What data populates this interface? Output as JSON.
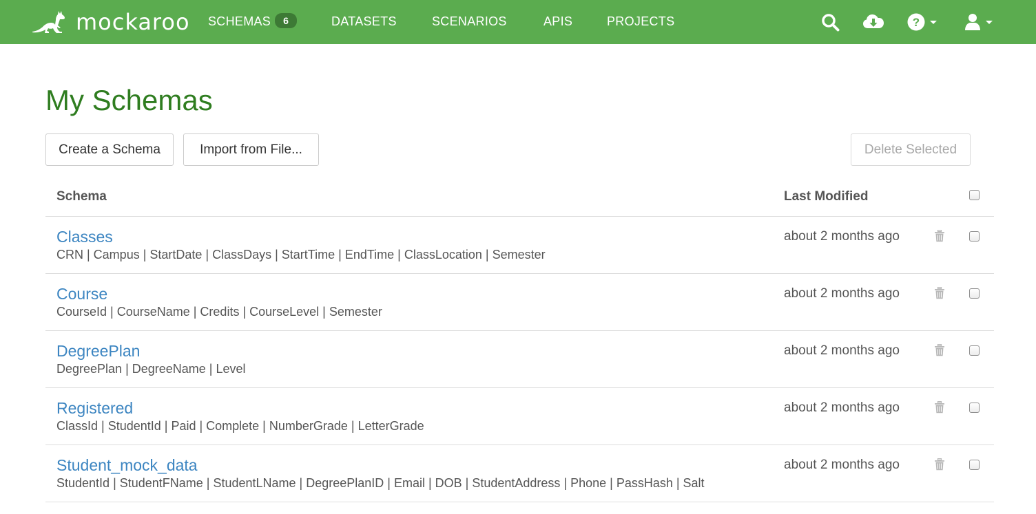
{
  "nav": {
    "brand": "mockaroo",
    "items": [
      {
        "label": "SCHEMAS",
        "badge": "6"
      },
      {
        "label": "DATASETS"
      },
      {
        "label": "SCENARIOS"
      },
      {
        "label": "APIS"
      },
      {
        "label": "PROJECTS"
      }
    ],
    "icons": [
      "search-icon",
      "cloud-download-icon",
      "help-icon",
      "user-icon"
    ]
  },
  "page": {
    "title": "My Schemas",
    "create_label": "Create a Schema",
    "import_label": "Import from File...",
    "delete_label": "Delete Selected"
  },
  "table": {
    "headers": {
      "schema": "Schema",
      "modified": "Last Modified"
    },
    "rows": [
      {
        "name": "Classes",
        "fields": "CRN | Campus | StartDate | ClassDays | StartTime | EndTime | ClassLocation | Semester",
        "modified": "about 2 months ago"
      },
      {
        "name": "Course",
        "fields": "CourseId | CourseName | Credits | CourseLevel | Semester",
        "modified": "about 2 months ago"
      },
      {
        "name": "DegreePlan",
        "fields": "DegreePlan | DegreeName | Level",
        "modified": "about 2 months ago"
      },
      {
        "name": "Registered",
        "fields": "ClassId | StudentId | Paid | Complete | NumberGrade | LetterGrade",
        "modified": "about 2 months ago"
      },
      {
        "name": "Student_mock_data",
        "fields": "StudentId | StudentFName | StudentLName | DegreePlanID | Email | DOB | StudentAddress | Phone | PassHash | Salt",
        "modified": "about 2 months ago"
      }
    ]
  },
  "colors": {
    "navbar": "#5bac4f",
    "badge": "#3d7a35",
    "title": "#2f7d20",
    "link": "#3c85c1"
  }
}
